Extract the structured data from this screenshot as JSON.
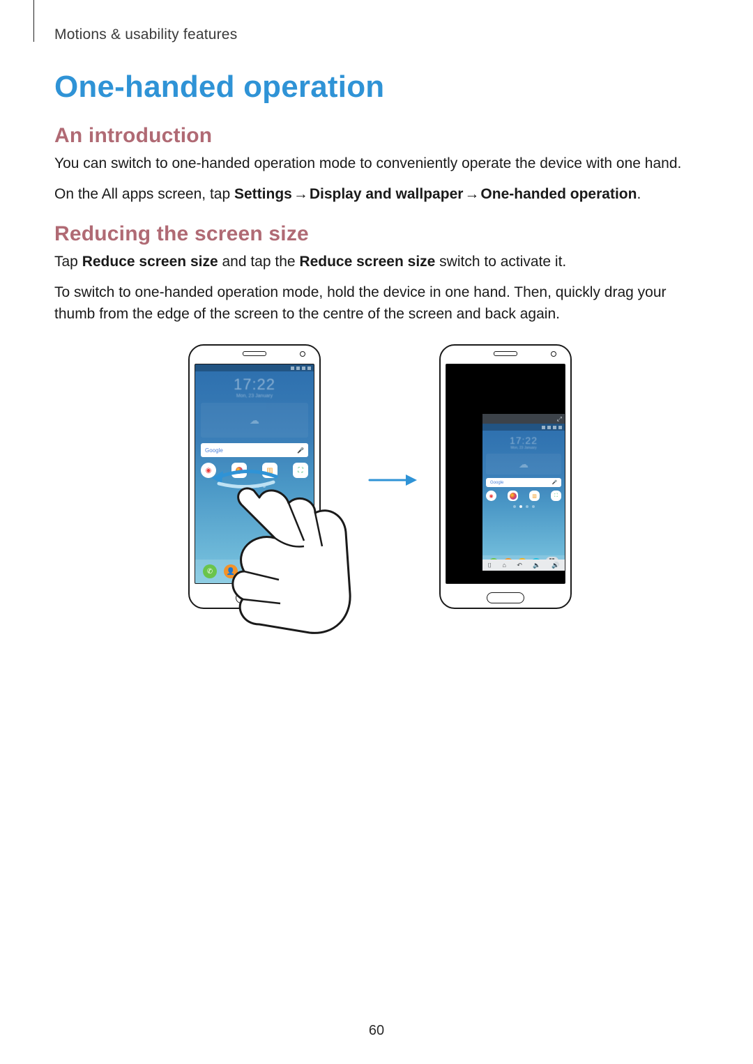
{
  "running_head": "Motions & usability features",
  "title": "One-handed operation",
  "section1": {
    "heading": "An introduction",
    "p1": "You can switch to one-handed operation mode to conveniently operate the device with one hand.",
    "p2_pre": "On the All apps screen, tap ",
    "p2_b1": "Settings",
    "p2_arrow": " → ",
    "p2_b2": "Display and wallpaper",
    "p2_b3": "One-handed operation",
    "p2_post": "."
  },
  "section2": {
    "heading": "Reducing the screen size",
    "p1_pre": "Tap ",
    "p1_b1": "Reduce screen size",
    "p1_mid": " and tap the ",
    "p1_b2": "Reduce screen size",
    "p1_post": " switch to activate it.",
    "p2": "To switch to one-handed operation mode, hold the device in one hand. Then, quickly drag your thumb from the edge of the screen to the centre of the screen and back again."
  },
  "figure": {
    "clock_time": "17:22",
    "clock_date": "Mon, 23 January",
    "search_label": "Google",
    "mic_glyph": "🎤",
    "weather_glyph": "☁",
    "nav": {
      "recent": "⌷",
      "home": "⌂",
      "back": "↶",
      "vol_down": "🔈",
      "vol_up": "🔊"
    },
    "dock_glyphs": {
      "phone": "✆",
      "contacts": "👤",
      "msg": "✉",
      "internet": "🌐"
    },
    "app_glyphs": {
      "rec": "◉",
      "gallery": "▥",
      "store": "⛶"
    },
    "close_glyph": "⤢"
  },
  "colors": {
    "title_blue": "#2f93d6",
    "section_mauve": "#b06a74",
    "arrow_blue": "#2f93d6"
  },
  "page_number": "60"
}
